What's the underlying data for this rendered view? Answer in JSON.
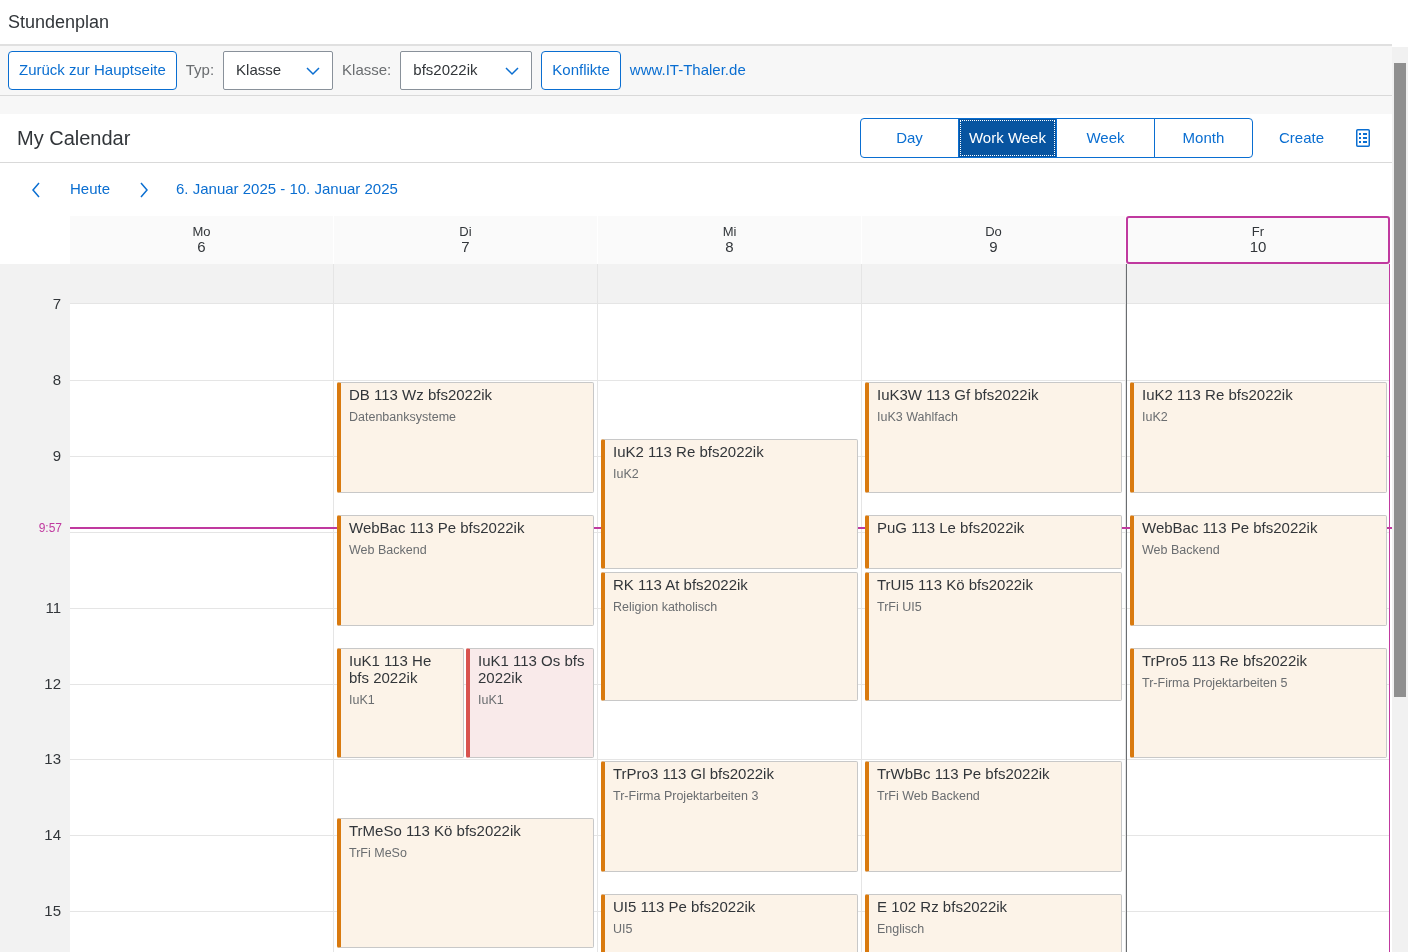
{
  "window": {
    "title": "Stundenplan"
  },
  "toolbar": {
    "back_button": "Zurück zur Hauptseite",
    "type_label": "Typ:",
    "type_value": "Klasse",
    "class_label": "Klasse:",
    "class_value": "bfs2022ik",
    "conflicts_button": "Konflikte",
    "link": "www.IT-Thaler.de"
  },
  "calendar": {
    "title": "My Calendar",
    "views": [
      {
        "label": "Day",
        "selected": false
      },
      {
        "label": "Work Week",
        "selected": true
      },
      {
        "label": "Week",
        "selected": false
      },
      {
        "label": "Month",
        "selected": false
      }
    ],
    "create_button": "Create",
    "today_button": "Heute",
    "range": "6. Januar 2025 - 10. Januar 2025",
    "days": [
      {
        "weekday": "Mo",
        "date": "6",
        "today": false
      },
      {
        "weekday": "Di",
        "date": "7",
        "today": false,
        "events": [
          {
            "title": "DB 113 Wz bfs2022ik",
            "subtitle": "Datenbanksysteme",
            "kind": "normal"
          },
          {
            "title": "WebBac 113 Pe bfs2022ik",
            "subtitle": "Web Backend",
            "kind": "normal"
          },
          {
            "title": "IuK1 113 He bfs 2022ik",
            "subtitle": "IuK1",
            "kind": "normal"
          },
          {
            "title": "IuK1 113 Os bfs 2022ik",
            "subtitle": "IuK1",
            "kind": "conflict"
          },
          {
            "title": "TrMeSo 113 Kö bfs2022ik",
            "subtitle": "TrFi MeSo",
            "kind": "normal"
          }
        ]
      },
      {
        "weekday": "Mi",
        "date": "8",
        "today": false,
        "events": [
          {
            "title": "IuK2 113 Re bfs2022ik",
            "subtitle": "IuK2",
            "kind": "normal"
          },
          {
            "title": "RK 113 At bfs2022ik",
            "subtitle": "Religion katholisch",
            "kind": "normal"
          },
          {
            "title": "TrPro3 113 Gl bfs2022ik",
            "subtitle": "Tr-Firma Projektarbeiten 3",
            "kind": "normal"
          },
          {
            "title": "UI5 113 Pe bfs2022ik",
            "subtitle": "UI5",
            "kind": "normal"
          }
        ]
      },
      {
        "weekday": "Do",
        "date": "9",
        "today": false,
        "events": [
          {
            "title": "IuK3W 113 Gf bfs2022ik",
            "subtitle": "IuK3 Wahlfach",
            "kind": "normal"
          },
          {
            "title": "PuG 113 Le bfs2022ik",
            "kind": "normal"
          },
          {
            "title": "TrUI5 113 Kö bfs2022ik",
            "subtitle": "TrFi UI5",
            "kind": "normal"
          },
          {
            "title": "TrWbBc 113 Pe bfs2022ik",
            "subtitle": "TrFi Web Backend",
            "kind": "normal"
          },
          {
            "title": "E 102 Rz bfs2022ik",
            "subtitle": "Englisch",
            "kind": "normal"
          }
        ]
      },
      {
        "weekday": "Fr",
        "date": "10",
        "today": true,
        "events": [
          {
            "title": "IuK2 113 Re bfs2022ik",
            "subtitle": "IuK2",
            "kind": "normal"
          },
          {
            "title": "WebBac 113 Pe bfs2022ik",
            "subtitle": "Web Backend",
            "kind": "normal"
          },
          {
            "title": "TrPro5 113 Re bfs2022ik",
            "subtitle": "Tr-Firma Projektarbeiten 5",
            "kind": "normal"
          }
        ]
      }
    ],
    "hours": [
      {
        "label": "7"
      },
      {
        "label": "8"
      },
      {
        "label": "9"
      },
      {
        "label": "11"
      },
      {
        "label": "12"
      },
      {
        "label": "13"
      },
      {
        "label": "14"
      },
      {
        "label": "15"
      }
    ],
    "now": {
      "label": "9:57"
    }
  }
}
